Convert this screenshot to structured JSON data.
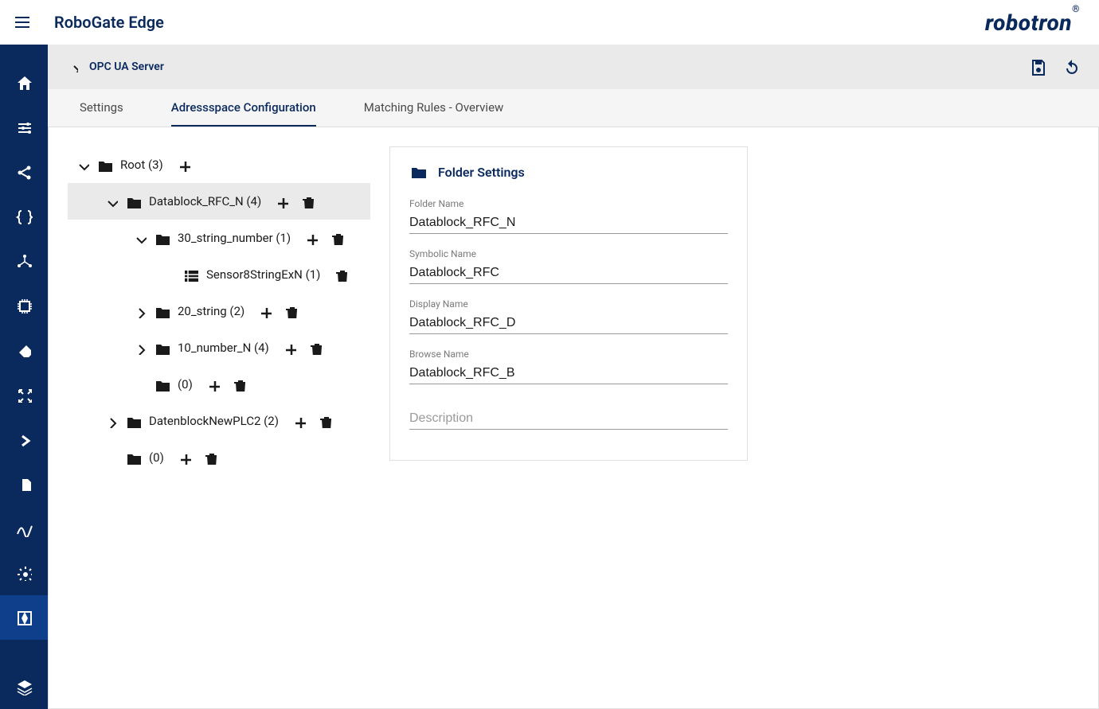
{
  "app": {
    "title": "RoboGate Edge",
    "brand": "robotron"
  },
  "breadcrumb": {
    "label": "OPC UA Server"
  },
  "tabs": {
    "settings": "Settings",
    "addressspace": "Adressspace Configuration",
    "matching": "Matching Rules - Overview"
  },
  "tree": {
    "root": "Root (3)",
    "datablock_rfc_n": "Datablock_RFC_N (4)",
    "string_number_30": "30_string_number (1)",
    "sensor8": "Sensor8StringExN (1)",
    "string_20": "20_string (2)",
    "number_10": "10_number_N (4)",
    "empty1": "(0)",
    "datenblock_new": "DatenblockNewPLC2 (2)",
    "empty2": "(0)"
  },
  "details": {
    "header": "Folder Settings",
    "labels": {
      "folder_name": "Folder Name",
      "symbolic_name": "Symbolic Name",
      "display_name": "Display Name",
      "browse_name": "Browse Name",
      "description": "Description"
    },
    "values": {
      "folder_name": "Datablock_RFC_N",
      "symbolic_name": "Datablock_RFC",
      "display_name": "Datablock_RFC_D",
      "browse_name": "Datablock_RFC_B",
      "description": ""
    }
  }
}
